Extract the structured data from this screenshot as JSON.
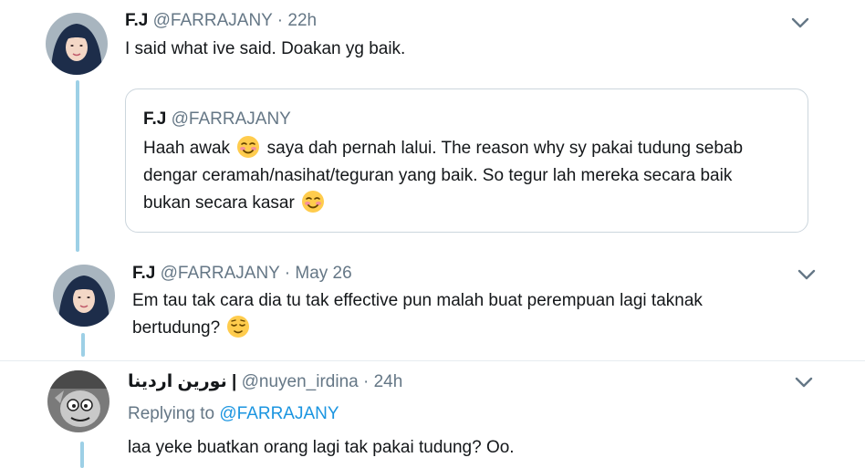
{
  "tweets": [
    {
      "name": "F.J",
      "handle": "@FARRAJANY",
      "time": "· 22h",
      "text": "I said what ive said. Doakan yg baik.",
      "avatar_icon": "hijab-woman-avatar",
      "quote": {
        "name": "F.J",
        "handle": "@FARRAJANY",
        "line1a": "Haah awak",
        "line1b": "saya dah pernah lalui. The reason why sy pakai tudung sebab",
        "line2": "dengar ceramah/nasihat/teguran yang baik. So tegur lah mereka secara baik",
        "line3": "bukan secara kasar",
        "emoji_icon": "smiling-blushing-face-icon"
      }
    },
    {
      "name": "F.J",
      "handle": "@FARRAJANY",
      "time": "· May 26",
      "line1": "Em tau tak cara dia tu tak effective pun malah buat perempuan lagi taknak",
      "line2": "bertudung?",
      "avatar_icon": "hijab-woman-avatar",
      "emoji_icon": "relieved-face-icon"
    },
    {
      "name": "نورين اردينا |",
      "handle": "@nuyen_irdina",
      "time": "· 24h",
      "replying_prefix": "Replying to",
      "replying_to": "@FARRAJANY",
      "text": "laa yeke buatkan orang lagi tak pakai tudung? Oo.",
      "avatar_icon": "cartoon-character-avatar"
    }
  ],
  "colors": {
    "thread_line": "#9dd0e6",
    "link": "#1b95e0",
    "muted": "#657786",
    "border": "#ccd6dd"
  }
}
